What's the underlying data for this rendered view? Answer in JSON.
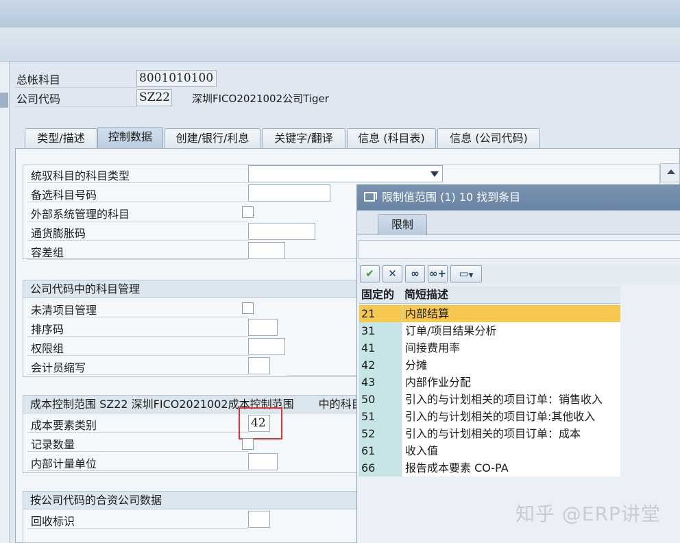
{
  "header": {
    "gl_account_label": "总帐科目",
    "gl_account_value": "8001010100",
    "company_code_label": "公司代码",
    "company_code_value": "SZ22",
    "company_name": "深圳FICO2021002公司Tiger"
  },
  "tabs": [
    {
      "label": "类型/描述"
    },
    {
      "label": "控制数据"
    },
    {
      "label": "创建/银行/利息"
    },
    {
      "label": "关键字/翻译"
    },
    {
      "label": "信息 (科目表)"
    },
    {
      "label": "信息 (公司代码)"
    }
  ],
  "group1": {
    "fields": [
      {
        "label": "统驭科目的科目类型"
      },
      {
        "label": "备选科目号码"
      },
      {
        "label": "外部系统管理的科目"
      },
      {
        "label": "通货膨胀码"
      },
      {
        "label": "容差组"
      }
    ]
  },
  "group2": {
    "title": "公司代码中的科目管理",
    "fields": [
      {
        "label": "未清项目管理"
      },
      {
        "label": "排序码"
      },
      {
        "label": "权限组"
      },
      {
        "label": "会计员缩写"
      }
    ]
  },
  "group3": {
    "title": "成本控制范围 SZ22 深圳FICO2021002成本控制范围",
    "title_suffix": "中的科目",
    "fields": [
      {
        "label": "成本要素类别",
        "value": "42"
      },
      {
        "label": "记录数量"
      },
      {
        "label": "内部计量单位"
      }
    ]
  },
  "group4": {
    "title": "按公司代码的合资公司数据",
    "fields": [
      {
        "label": "回收标识"
      }
    ]
  },
  "popup": {
    "title": "限制值范围 (1)   10 找到条目",
    "tab_label": "限制",
    "col_fixed": "固定的",
    "col_desc": "简短描述",
    "rows": [
      {
        "code": "21",
        "desc": "内部结算",
        "selected": true
      },
      {
        "code": "31",
        "desc": "订单/项目结果分析"
      },
      {
        "code": "41",
        "desc": "间接费用率"
      },
      {
        "code": "42",
        "desc": "分摊"
      },
      {
        "code": "43",
        "desc": "内部作业分配"
      },
      {
        "code": "50",
        "desc": "引入的与计划相关的项目订单：销售收入"
      },
      {
        "code": "51",
        "desc": "引入的与计划相关的项目订单:其他收入"
      },
      {
        "code": "52",
        "desc": "引入的与计划相关的项目订单：成本"
      },
      {
        "code": "61",
        "desc": "收入值"
      },
      {
        "code": "66",
        "desc": "报告成本要素 CO-PA"
      }
    ]
  },
  "watermark": "知乎 @ERP讲堂",
  "colors": {
    "selected_row": "#f6c94e",
    "code_column": "#c7e5e7",
    "popup_title_bar": "#6883a4",
    "highlight_box": "#e03030"
  }
}
